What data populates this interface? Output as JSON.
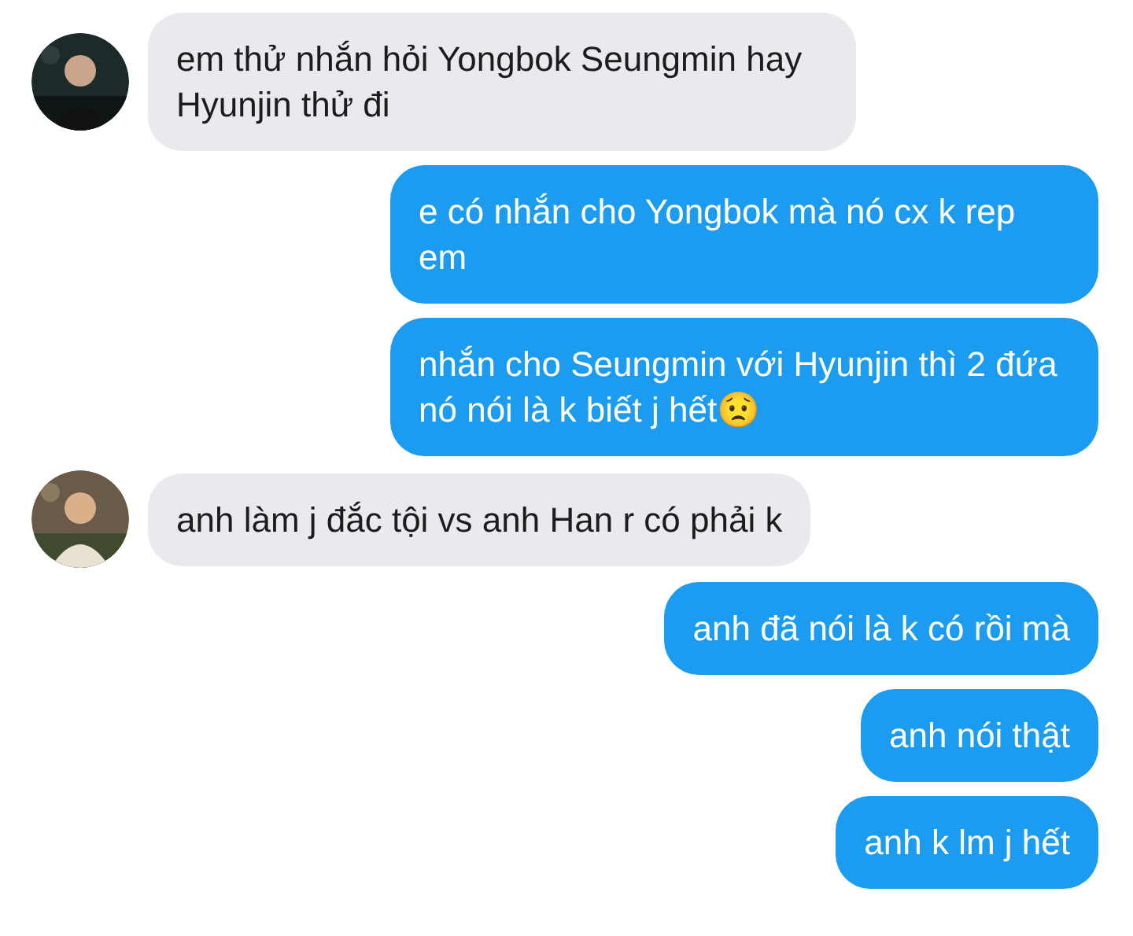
{
  "messages": [
    {
      "kind": "incoming",
      "text": "em thử nhắn hỏi Yongbok Seungmin hay Hyunjin thử đi"
    },
    {
      "kind": "outgoing",
      "text": "e có nhắn cho Yongbok mà nó cx k rep em"
    },
    {
      "kind": "outgoing",
      "text": "nhắn cho Seungmin với Hyunjin thì 2 đứa nó nói là k biết j hết😟"
    },
    {
      "kind": "incoming",
      "text": "anh làm j đắc tội vs anh Han r có phải k"
    },
    {
      "kind": "outgoing",
      "text": "anh đã nói là k có rồi mà"
    },
    {
      "kind": "outgoing",
      "text": "anh nói thật"
    },
    {
      "kind": "outgoing",
      "text": "anh k lm j hết"
    }
  ]
}
